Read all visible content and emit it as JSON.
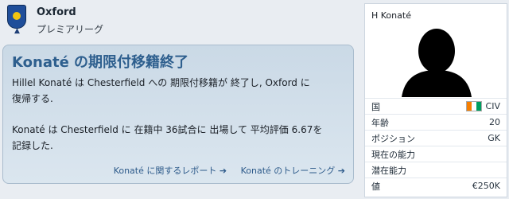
{
  "header": {
    "club": "Oxford",
    "league": "プレミアリーグ",
    "crest_icon": "oxford-crest-icon"
  },
  "news": {
    "title": "Konaté の期限付移籍終了",
    "para1_line1": "Hillel Konaté は Chesterfield への 期限付移籍が 終了し, Oxford に",
    "para1_line2": "復帰する.",
    "para2_line1": "Konaté は Chesterfield に 在籍中 36試合に 出場して 平均評価 6.67を",
    "para2_line2": "記録した.",
    "link_report": "Konaté に関するレポート",
    "link_training": "Konaté のトレーニング",
    "arrow": "➔"
  },
  "player": {
    "name": "H Konaté",
    "rows": [
      {
        "label": "国",
        "value": "CIV"
      },
      {
        "label": "年齢",
        "value": "20"
      },
      {
        "label": "ポジション",
        "value": "GK"
      },
      {
        "label": "現在の能力",
        "value": ""
      },
      {
        "label": "潜在能力",
        "value": ""
      },
      {
        "label": "値",
        "value": "€250K"
      }
    ]
  },
  "colors": {
    "title_blue": "#2e5f8e",
    "flag": [
      "#f77f00",
      "#ffffff",
      "#009e60"
    ]
  }
}
